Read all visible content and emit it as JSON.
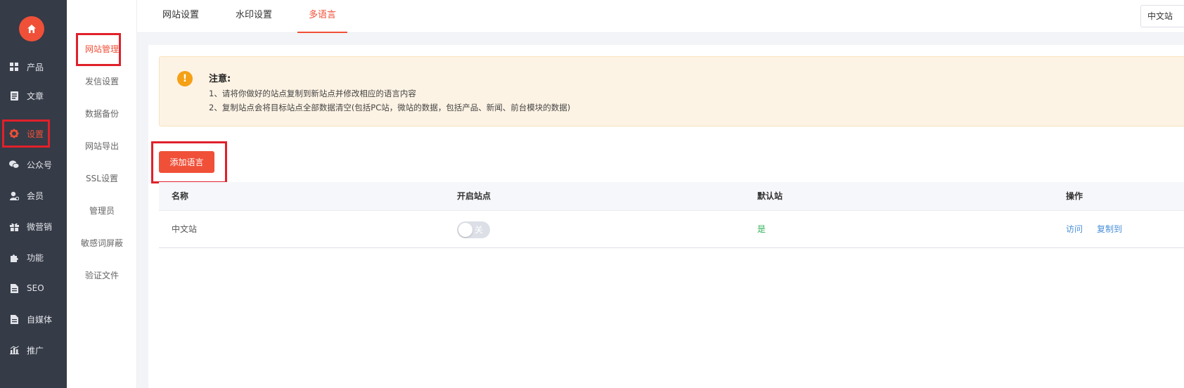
{
  "sidebar": {
    "items": [
      {
        "label": "产品",
        "icon": "grid-icon"
      },
      {
        "label": "文章",
        "icon": "document-icon"
      },
      {
        "label": "设置",
        "icon": "gear-icon"
      },
      {
        "label": "公众号",
        "icon": "wechat-icon"
      },
      {
        "label": "会员",
        "icon": "user-icon"
      },
      {
        "label": "微营销",
        "icon": "gift-icon"
      },
      {
        "label": "功能",
        "icon": "puzzle-icon"
      },
      {
        "label": "SEO",
        "icon": "file-icon"
      },
      {
        "label": "自媒体",
        "icon": "file-icon"
      },
      {
        "label": "推广",
        "icon": "chart-icon"
      }
    ],
    "active_index": 2
  },
  "submenu": {
    "items": [
      "网站管理",
      "发信设置",
      "数据备份",
      "网站导出",
      "SSL设置",
      "管理员",
      "敏感词屏蔽",
      "验证文件"
    ],
    "active_index": 0
  },
  "tabs": [
    "网站设置",
    "水印设置",
    "多语言"
  ],
  "active_tab": 2,
  "language_select": "中文站",
  "notice": {
    "title": "注意:",
    "line1": "1、请将你做好的站点复制到新站点并修改相应的语言内容",
    "line2": "2、复制站点会将目标站点全部数据清空(包括PC站，微站的数据，包括产品、新闻、前台模块的数据)"
  },
  "add_button": "添加语言",
  "table": {
    "headers": [
      "名称",
      "开启站点",
      "默认站",
      "操作"
    ],
    "rows": [
      {
        "name": "中文站",
        "switch_label": "关",
        "switch_on": false,
        "default": "是",
        "actions": [
          "访问",
          "复制到"
        ]
      }
    ]
  },
  "colors": {
    "accent": "#f05038",
    "sidebar_bg": "#353b47",
    "highlight_box": "#e0212b",
    "link": "#4a8fd8",
    "success": "#31b257"
  }
}
